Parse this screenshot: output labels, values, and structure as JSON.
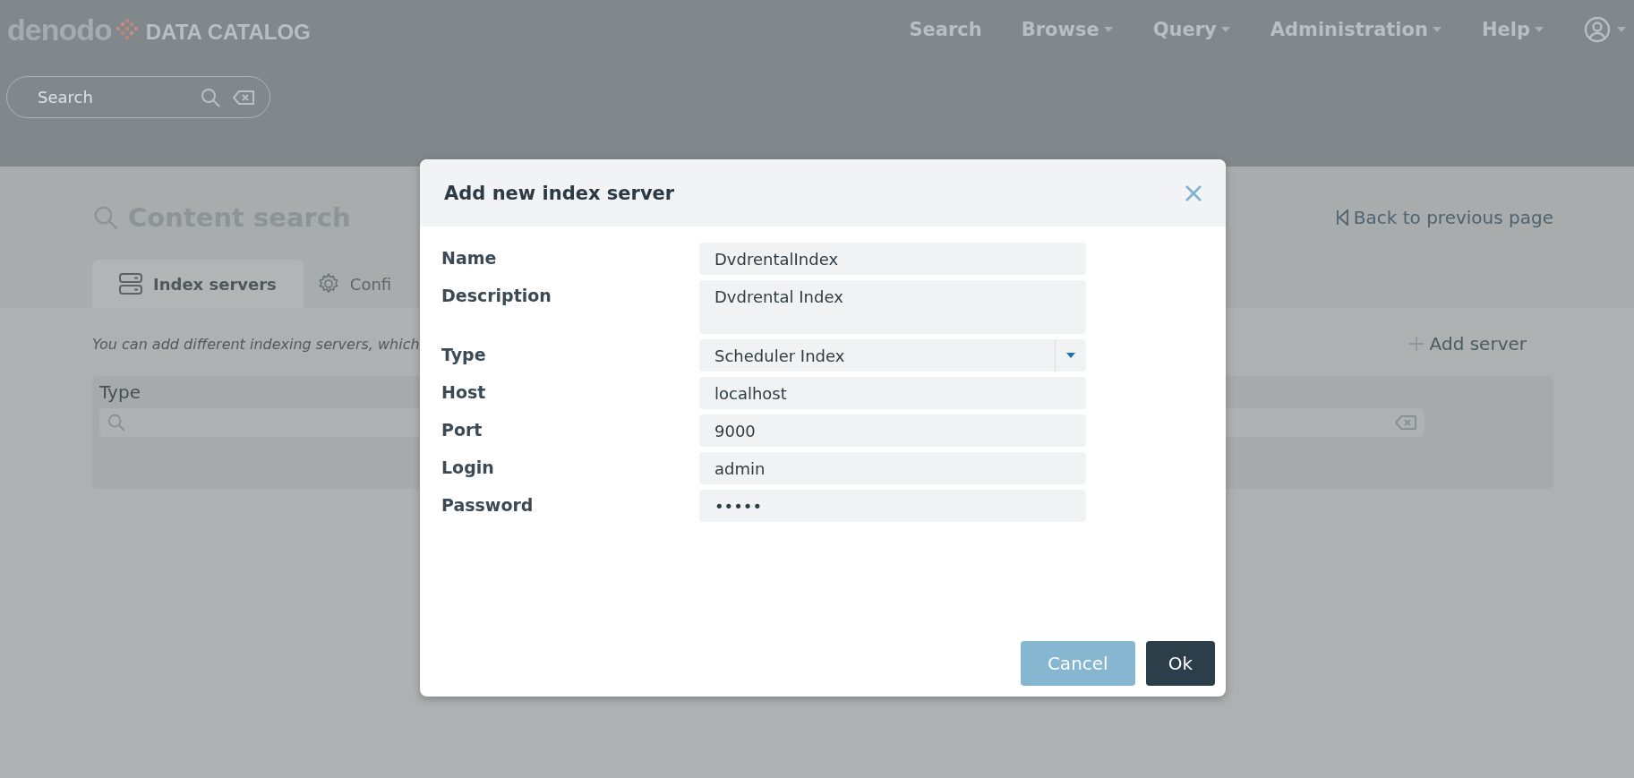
{
  "header": {
    "brand": "denodo",
    "product": "DATA CATALOG",
    "nav": [
      {
        "label": "Search",
        "dropdown": false
      },
      {
        "label": "Browse",
        "dropdown": true
      },
      {
        "label": "Query",
        "dropdown": true
      },
      {
        "label": "Administration",
        "dropdown": true
      },
      {
        "label": "Help",
        "dropdown": true
      }
    ],
    "search": {
      "placeholder": "Search"
    }
  },
  "page": {
    "title": "Content search",
    "back_link": "Back to previous page",
    "tabs": [
      {
        "label": "Index servers",
        "selected": true
      },
      {
        "label": "Confi",
        "selected": false
      }
    ],
    "hint": "You can add different indexing servers, which",
    "add_button": "Add server",
    "table": {
      "columns": [
        {
          "label": "Type"
        }
      ]
    }
  },
  "dialog": {
    "title": "Add new index server",
    "fields": [
      {
        "label": "Name",
        "kind": "text",
        "value": "DvdrentalIndex"
      },
      {
        "label": "Description",
        "kind": "textarea",
        "value": "Dvdrental Index"
      },
      {
        "label": "Type",
        "kind": "select",
        "value": "Scheduler Index"
      },
      {
        "label": "Host",
        "kind": "text",
        "value": "localhost"
      },
      {
        "label": "Port",
        "kind": "text",
        "value": "9000"
      },
      {
        "label": "Login",
        "kind": "text",
        "value": "admin"
      },
      {
        "label": "Password",
        "kind": "text",
        "value": "•••••"
      }
    ],
    "buttons": [
      {
        "label": "Cancel",
        "kind": "secondary"
      },
      {
        "label": "Ok",
        "kind": "primary"
      }
    ]
  }
}
